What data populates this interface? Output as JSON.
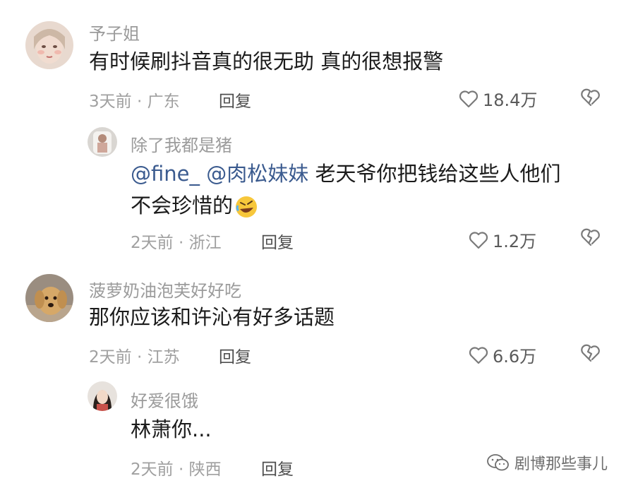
{
  "comments": [
    {
      "username": "予子姐",
      "text": "有时候刷抖音真的很无助 真的很想报警",
      "meta": "3天前 · 广东",
      "reply_label": "回复",
      "likes": "18.4万"
    },
    {
      "username": "除了我都是猪",
      "mention1": "@fine_",
      "mention2": "@肉松妹妹",
      "text_line1": " 老天爷你把钱给这些人他们",
      "text_line2": "不会珍惜的",
      "emoji": "rolling-on-floor-laughing-emoji",
      "meta": "2天前 · 浙江",
      "reply_label": "回复",
      "likes": "1.2万"
    },
    {
      "username": "菠萝奶油泡芙好好吃",
      "text": "那你应该和许沁有好多话题",
      "meta": "2天前 · 江苏",
      "reply_label": "回复",
      "likes": "6.6万"
    },
    {
      "username": "好爱很饿",
      "text": "林萧你...",
      "meta": "2天前 · 陕西",
      "reply_label": "回复"
    }
  ],
  "watermark": "剧博那些事儿",
  "icons": {
    "like": "heart-outline-icon",
    "dislike": "broken-heart-icon",
    "watermark": "wechat-icon"
  },
  "colors": {
    "mention": "#3b5b8f",
    "meta": "#a0a0a0",
    "text": "#1b1b1b"
  }
}
